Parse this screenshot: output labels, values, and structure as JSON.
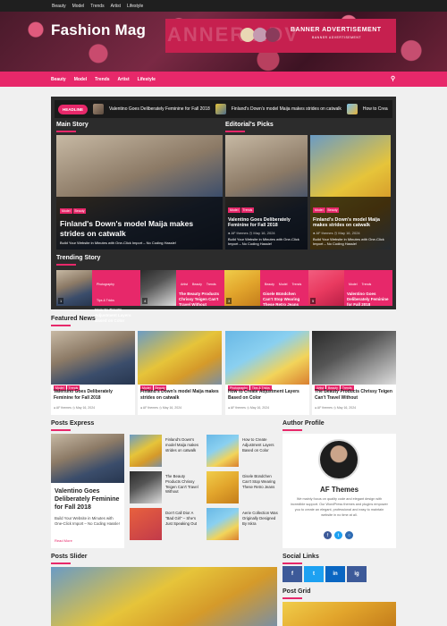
{
  "topbar": {
    "links": [
      "Beauty",
      "Model",
      "Trends",
      "Artist",
      "Lifestyle"
    ]
  },
  "header": {
    "logo": "Fashion Mag",
    "banner_ghost": "ANNER ADV",
    "banner_title": "BANNER ADVERTISEMENT",
    "banner_sub": "BANNER ADVERTISEMENT"
  },
  "nav": {
    "items": [
      "Beauty",
      "Model",
      "Trends",
      "Artist",
      "Lifestyle"
    ],
    "search_icon": "search-icon"
  },
  "ticker": {
    "label": "HEADLINE",
    "items": [
      "Valentino Goes Deliberately Feminine for Fall 2018",
      "Finland's Down's model Maija makes strides on catwalk",
      "How to Crea"
    ]
  },
  "main_story": {
    "heading": "Main Story",
    "tags": [
      "Model",
      "Beauty"
    ],
    "title": "Finland's Down's model Maija makes strides on catwalk",
    "excerpt": "Build Your Website in Minutes with One-Click Import – No Coding Hassle!"
  },
  "editorials": {
    "heading": "Editorial's Picks",
    "cards": [
      {
        "tags": [
          "Model",
          "Trends"
        ],
        "title": "Valentino Goes Deliberately Feminine for Fall 2018",
        "author": "AF themes",
        "date": "May 16, 2024",
        "excerpt": "Build Your Website in Minutes with One-Click Import – No Coding Hassle!"
      },
      {
        "tags": [
          "Model",
          "Beauty"
        ],
        "title": "Finland's Down's model Maija makes strides on catwalk",
        "author": "AF themes",
        "date": "May 16, 2024",
        "excerpt": "Build Your Website in Minutes with One-Click Import – No Coding Hassle!"
      }
    ]
  },
  "trending": {
    "heading": "Trending Story",
    "items": [
      {
        "num": "1",
        "tags": [
          "Photography",
          "Tips & Tricks"
        ],
        "title": "How to Create Adjustment Layers Based on Color"
      },
      {
        "num": "4",
        "tags": [
          "Artist",
          "Beauty",
          "Trends"
        ],
        "title": "The Beauty Products Chrissy Teigen Can't Travel Without"
      },
      {
        "num": "3",
        "tags": [
          "Beauty",
          "Model",
          "Trends"
        ],
        "title": "Gisele Bündchen Can't Stop Wearing These Retro Jeans"
      },
      {
        "num": "5",
        "tags": [
          "Model",
          "Trends"
        ],
        "title": "Valentino Goes Deliberately Feminine for Fall 2018"
      }
    ]
  },
  "featured": {
    "heading": "Featured News",
    "items": [
      {
        "tags": [
          "Model",
          "Trends"
        ],
        "title": "Valentino Goes Deliberately Feminine for Fall 2018",
        "author": "AF themes",
        "date": "May 16, 2024"
      },
      {
        "tags": [
          "Model",
          "Beauty"
        ],
        "title": "Finland's Down's model Maija makes strides on catwalk",
        "author": "AF themes",
        "date": "May 16, 2024"
      },
      {
        "tags": [
          "Photography",
          "Tips & Tricks"
        ],
        "title": "How to Create Adjustment Layers Based on Color",
        "author": "AF themes",
        "date": "May 16, 2024"
      },
      {
        "tags": [
          "Artist",
          "Beauty",
          "Trends"
        ],
        "title": "The Beauty Products Chrissy Teigen Can't Travel Without",
        "author": "AF themes",
        "date": "May 16, 2024"
      }
    ]
  },
  "posts_express": {
    "heading": "Posts Express",
    "big": {
      "title": "Valentino Goes Deliberately Feminine for Fall 2018",
      "excerpt": "Build Your Website in Minutes with One-Click Import – No Coding Hassle!",
      "read_more": "Read More"
    },
    "small": [
      "Finland's Down's model Maija makes strides on catwalk",
      "How to Create Adjustment Layers Based on Color",
      "The Beauty Products Chrissy Teigen Can't Travel Without",
      "Gisele Bündchen Can't Stop Wearing These Retro Jeans",
      "Don't Call Dior A \"Bad Girl\" – She's Just Speaking Out",
      "Aerie Collection Was Originally Designed By Iskra"
    ]
  },
  "author_profile": {
    "heading": "Author Profile",
    "name": "AF Themes",
    "bio": "We mainly focus on quality code and elegant design with incredible support. Our WordPress themes and plugins empower you to create an elegant, professional and easy to maintain website in no time at all."
  },
  "posts_slider": {
    "heading": "Posts Slider"
  },
  "social_links": {
    "heading": "Social Links",
    "icons": [
      "f",
      "t",
      "in",
      "ig"
    ]
  },
  "post_grid": {
    "heading": "Post Grid"
  },
  "colors": {
    "accent": "#e7286a",
    "dark": "#2c2c2c"
  }
}
